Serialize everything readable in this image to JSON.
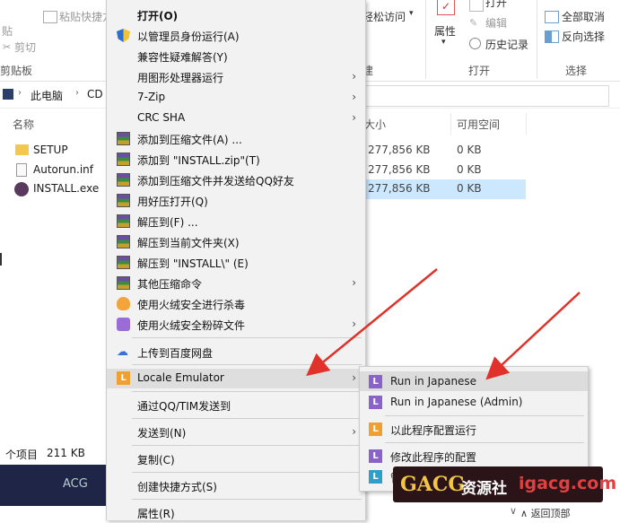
{
  "ribbon": {
    "paste_shortcut": "粘贴快捷方",
    "paste": "贴",
    "cut": "剪切",
    "clipboard_group": "剪贴板",
    "easy_access": "轻松访问",
    "properties": "属性",
    "open_small": "打开",
    "edit": "编辑",
    "history": "历史记录",
    "open_group": "打开",
    "select_all": "全部取消",
    "invert_select": "反向选择",
    "select_group": "选择",
    "new_group_tail": "建"
  },
  "address": {
    "this_pc": "此电脑",
    "drive": "CD"
  },
  "columns": {
    "name": "名称",
    "size": "大小",
    "free": "可用空间"
  },
  "files": [
    {
      "name": "SETUP",
      "size": "277,856 KB",
      "free": "0 KB"
    },
    {
      "name": "Autorun.inf",
      "size": "277,856 KB",
      "free": "0 KB"
    },
    {
      "name": "INSTALL.exe",
      "size": "277,856 KB",
      "free": "0 KB"
    }
  ],
  "status": {
    "count": "个项目",
    "size": "211 KB"
  },
  "menu": {
    "open": "打开(O)",
    "run_as_admin": "以管理员身份运行(A)",
    "compat": "兼容性疑难解答(Y)",
    "gpu_run": "用图形处理器运行",
    "zip7": "7-Zip",
    "crc": "CRC SHA",
    "add_archive": "添加到压缩文件(A) ...",
    "add_zip": "添加到 \"INSTALL.zip\"(T)",
    "add_send_qq": "添加到压缩文件并发送给QQ好友",
    "open_haozip": "用好压打开(Q)",
    "extract": "解压到(F) ...",
    "extract_here": "解压到当前文件夹(X)",
    "extract_install": "解压到 \"INSTALL\\\" (E)",
    "other_cmd": "其他压缩命令",
    "huorong_scan": "使用火绒安全进行杀毒",
    "huorong_shred": "使用火绒安全粉碎文件",
    "baidu_upload": "上传到百度网盘",
    "locale_emulator": "Locale Emulator",
    "send_qq_tim": "通过QQ/TIM发送到",
    "send_to": "发送到(N)",
    "copy": "复制(C)",
    "create_shortcut": "创建快捷方式(S)",
    "properties": "属性(R)"
  },
  "submenu": {
    "run_japanese": "Run in Japanese",
    "run_japanese_admin": "Run in Japanese (Admin)",
    "config_run": "以此程序配置运行",
    "modify_config": "修改此程序的配置",
    "manage": "管"
  },
  "watermark": {
    "brand": "GACG",
    "site": "资源社",
    "domain": "igacg.com"
  },
  "bottom": {
    "back_to_top": "返回顶部",
    "acg": "ACG"
  },
  "colors": {
    "selection": "#cce8ff",
    "arrow_red": "#e0312b",
    "le_orange": "#f0a030",
    "le_purple": "#8a63c8",
    "le_teal": "#2f9fc8"
  }
}
